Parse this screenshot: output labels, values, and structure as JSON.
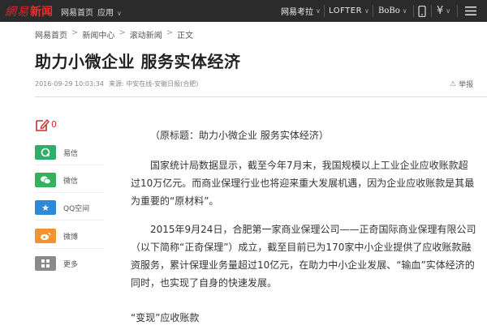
{
  "topbar": {
    "logo_text_1": "網易",
    "logo_text_2": "新闻",
    "home_link": "网易首页",
    "app_menu": "应用",
    "kaola": "网易考拉",
    "lofter": "LOFTER",
    "bobo": "BoBo"
  },
  "breadcrumb": [
    "网易首页",
    "新闻中心",
    "滚动新闻",
    "正文"
  ],
  "article": {
    "title": "助力小微企业 服务实体经济",
    "datetime": "2016-09-29 10:03:34",
    "source": "来源: 中安在线-安徽日报(合肥)",
    "report_label": "举报",
    "paragraphs": [
      "（原标题：助力小微企业 服务实体经济）",
      "国家统计局数据显示，截至今年7月末，我国规模以上工业企业应收账款超过10万亿元。而商业保理行业也将迎来重大发展机遇，因为企业应收账款是其最为重要的“原材料”。",
      "2015年9月24日，合肥第一家商业保理公司——正奇国际商业保理有限公司（以下简称“正奇保理”）成立，截至目前已为170家中小企业提供了应收账款融资服务，累计保理业务量超过10亿元，在助力中小企业发展、“输血”实体经济的同时，也实现了自身的快速发展。",
      "“变现”应收账款"
    ]
  },
  "sidebar": {
    "comment_count": "0",
    "share_items": [
      {
        "label": "易信",
        "icon": "yixin-icon",
        "color": "#2fae6a"
      },
      {
        "label": "微信",
        "icon": "wechat-icon",
        "color": "#36b15b"
      },
      {
        "label": "QQ空间",
        "icon": "qzone-icon",
        "color": "#2e8ad8"
      },
      {
        "label": "微博",
        "icon": "weibo-icon",
        "color": "#f2932f"
      },
      {
        "label": "更多",
        "icon": "more-icon",
        "color": "#8a8a8a"
      }
    ]
  },
  "colors": {
    "topbar_bg": "#2b2b2b",
    "brand_red": "#c62e2e"
  }
}
